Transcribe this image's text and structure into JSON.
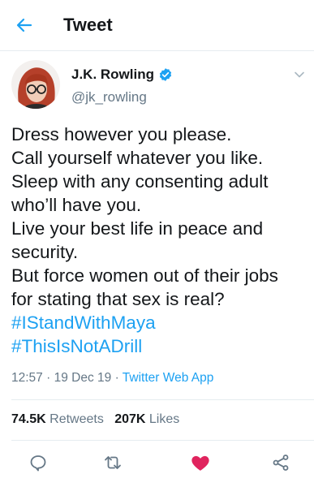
{
  "header": {
    "back_icon": "arrow-left-icon",
    "title": "Tweet"
  },
  "author": {
    "display_name": "J.K. Rowling",
    "handle": "@jk_rowling",
    "verified": true
  },
  "tweet": {
    "lines": [
      "Dress however you please.",
      "Call yourself whatever you like.",
      "Sleep with any consenting adult",
      "who’ll have you.",
      "Live your best life in peace and",
      "security.",
      "But force women out of their jobs",
      "for stating that sex is real?"
    ],
    "hashtags": [
      "#IStandWithMaya",
      "#ThisIsNotADrill"
    ]
  },
  "meta": {
    "time": "12:57",
    "separator": "·",
    "date": "19 Dec 19",
    "source": "Twitter Web App"
  },
  "stats": {
    "retweets_count": "74.5K",
    "retweets_label": "Retweets",
    "likes_count": "207K",
    "likes_label": "Likes"
  },
  "actions": [
    {
      "name": "reply",
      "icon": "speech-bubble-icon"
    },
    {
      "name": "retweet",
      "icon": "retweet-arrows-icon"
    },
    {
      "name": "like",
      "icon": "heart-icon",
      "active": true
    },
    {
      "name": "share",
      "icon": "share-nodes-icon"
    }
  ],
  "colors": {
    "accent": "#1da1f2",
    "like": "#e0245e",
    "text": "#14171a",
    "muted": "#657786",
    "divider": "#e6ecf0"
  }
}
